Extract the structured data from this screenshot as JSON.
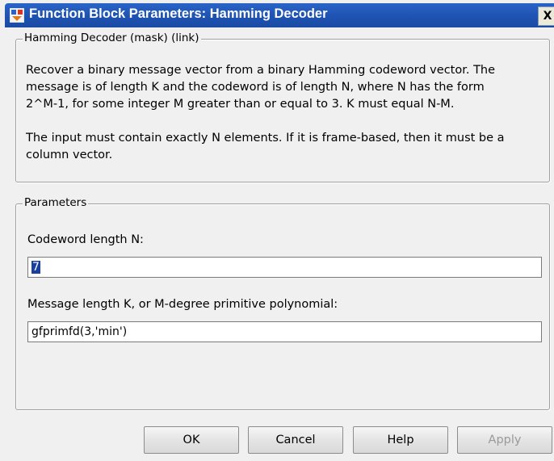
{
  "window": {
    "title": "Function Block Parameters: Hamming Decoder",
    "close_label": "X"
  },
  "description_group": {
    "legend": "Hamming Decoder (mask) (link)",
    "paragraph1_line1": "Recover a binary message vector from a binary Hamming codeword vector.  The",
    "paragraph1_line2": "message is of length K and the codeword is of length N, where N has the form",
    "paragraph1_line3": "2^M-1, for some integer M greater than or equal to 3.  K must equal N-M.",
    "paragraph2_line1": "The input must contain exactly N elements.  If it is frame-based, then it must be a",
    "paragraph2_line2": "column vector."
  },
  "parameters_group": {
    "legend": "Parameters",
    "codeword_label": "Codeword length N:",
    "codeword_value": "7",
    "message_label": "Message length K, or M-degree primitive polynomial:",
    "message_value": "gfprimfd(3,'min')"
  },
  "buttons": {
    "ok": "OK",
    "cancel": "Cancel",
    "help": "Help",
    "apply": "Apply"
  },
  "colors": {
    "titlebar": "#1f54b4",
    "selection": "#1a3f9e"
  }
}
